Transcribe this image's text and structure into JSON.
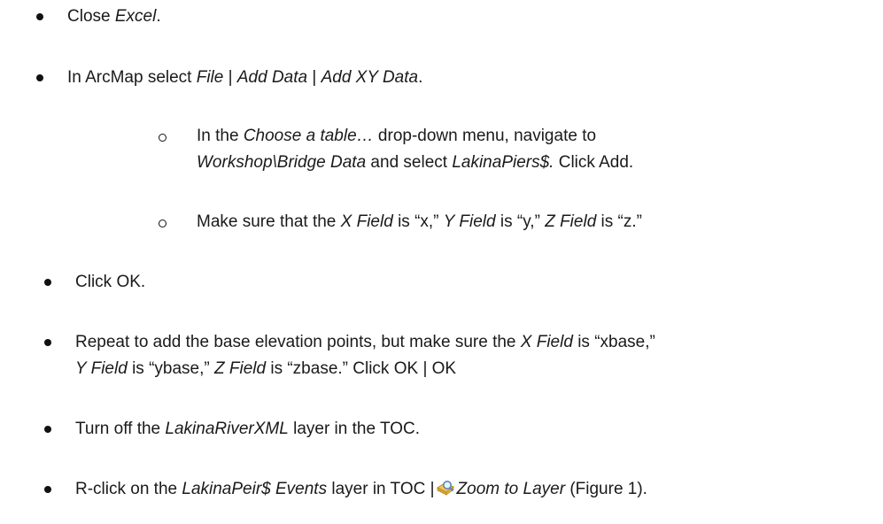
{
  "steps": {
    "s1": {
      "text1": "Close ",
      "em1": "Excel",
      "text2": "."
    },
    "s2": {
      "text1": "In ArcMap select ",
      "em1": "File",
      "sep1": " | ",
      "em2": "Add Data",
      "sep2": " | ",
      "em3": "Add XY Data",
      "text2": "."
    },
    "s3": {
      "text1": "In the ",
      "em1": "Choose a table…",
      "text2": " drop-down menu, navigate to",
      "em2": "Workshop\\Bridge Data",
      "text3": " and select ",
      "em3": "LakinaPiers$.",
      "text4": " Click Add."
    },
    "s4": {
      "text1": "Make sure that the ",
      "em1": "X Field",
      "text2": " is “x,” ",
      "em2": "Y Field",
      "text3": " is “y,” ",
      "em3": "Z Field",
      "text4": " is “z.”"
    },
    "s5": {
      "text1": "Click OK."
    },
    "s6": {
      "text1": "Repeat to add the base elevation points, but make sure the ",
      "em1": "X Field",
      "text2": " is “xbase,”",
      "em2": "Y Field",
      "text3": " is “ybase,” ",
      "em3": "Z Field",
      "text4": " is “zbase.” Click OK | OK"
    },
    "s7": {
      "text1": "Turn off the ",
      "em1": "LakinaRiverXML",
      "text2": " layer in the TOC."
    },
    "s8": {
      "text1": "R-click on the ",
      "em1": "LakinaPeir$ Events",
      "text2": " layer in TOC |",
      "icon": "zoom-to-layer-icon",
      "em2": "Zoom to Layer",
      "text3": " (Figure 1)."
    }
  }
}
